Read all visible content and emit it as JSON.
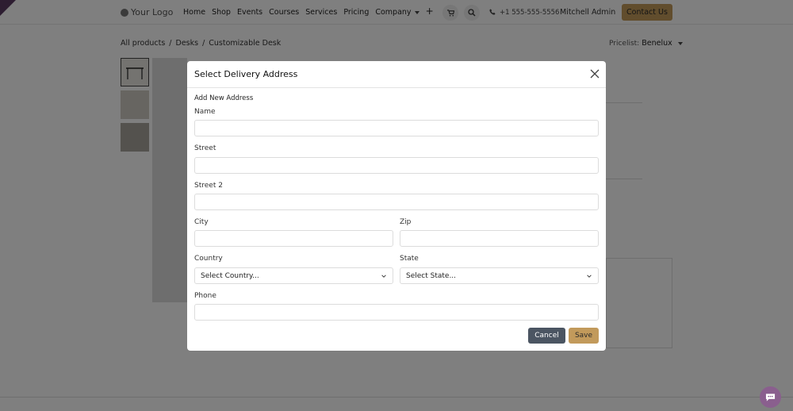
{
  "nav": {
    "logo_text": "Your Logo",
    "menu": [
      "Home",
      "Shop",
      "Events",
      "Courses",
      "Services",
      "Pricing",
      "Company"
    ],
    "plus": "+",
    "phone": "+1 555-555-5556",
    "user": "Mitchell Admin",
    "contact": "Contact Us"
  },
  "breadcrumb": {
    "items": [
      "All products",
      "Desks",
      "Customizable Desk"
    ],
    "sep": "/"
  },
  "pricelist": {
    "label": "Pricelist:",
    "value": "Benelux"
  },
  "modal": {
    "title": "Select Delivery Address",
    "section_title": "Add New Address",
    "fields": {
      "name": "Name",
      "street": "Street",
      "street2": "Street 2",
      "city": "City",
      "zip": "Zip",
      "country": "Country",
      "state": "State",
      "phone": "Phone"
    },
    "country_placeholder": "Select Country...",
    "state_placeholder": "Select State...",
    "cancel": "Cancel",
    "save": "Save"
  },
  "colors": {
    "accent": "#c29a5b",
    "cancel_bg": "#4b5562",
    "corner": "#5b3a63",
    "chat": "#8a5f8e"
  },
  "icons": {
    "cart": "cart-icon",
    "search": "search-icon",
    "phone": "phone-icon",
    "close": "close-icon",
    "chevron": "chevron-down-icon",
    "chat": "chat-icon"
  }
}
